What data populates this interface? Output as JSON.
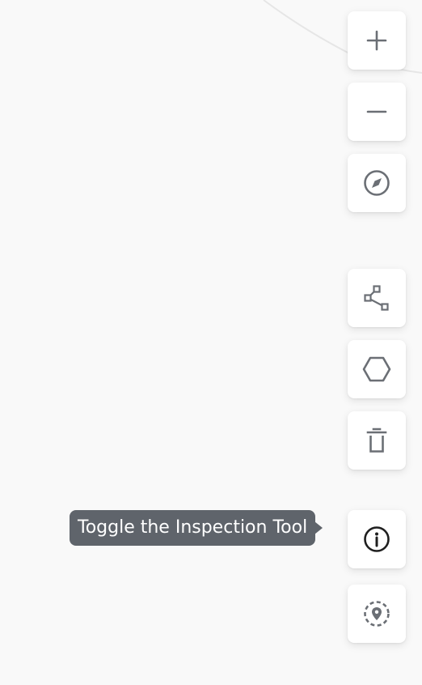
{
  "map": {
    "background_color": "#f9f9f9",
    "road_color": "#e8e8e8"
  },
  "controls": {
    "zoom_in": {
      "icon": "plus-icon"
    },
    "zoom_out": {
      "icon": "minus-icon"
    },
    "compass": {
      "icon": "compass-icon"
    },
    "draw_line": {
      "icon": "polyline-icon"
    },
    "draw_polygon": {
      "icon": "hexagon-icon"
    },
    "delete": {
      "icon": "trash-icon"
    },
    "inspect": {
      "icon": "info-icon"
    },
    "geolocate": {
      "icon": "location-pin-icon"
    }
  },
  "tooltip": {
    "text": "Toggle the Inspection Tool"
  },
  "colors": {
    "icon": "#6b6f75",
    "icon_active": "#1f1f1f",
    "tooltip_bg": "#5f646b"
  }
}
